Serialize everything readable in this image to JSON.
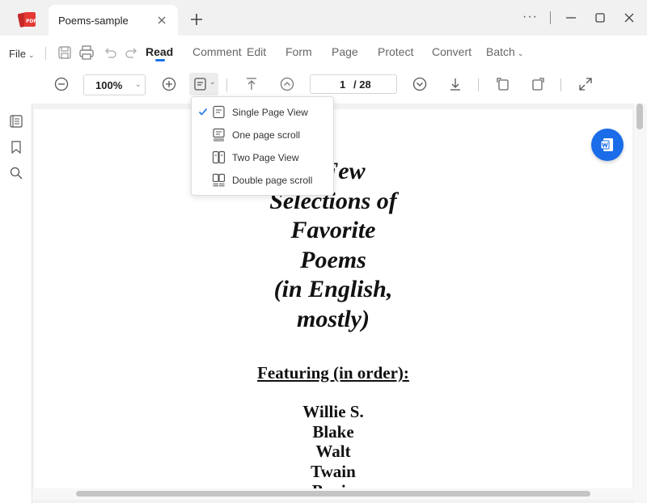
{
  "window": {
    "tab_title": "Poems-sample",
    "more_label": "···"
  },
  "menu": {
    "file_label": "File",
    "tabs": [
      "Read",
      "Comment",
      "Edit",
      "Form",
      "Page",
      "Protect",
      "Convert",
      "Batch"
    ],
    "active_tab": "Read"
  },
  "toolbar": {
    "zoom": "100%",
    "page_current": "1",
    "page_total": "/ 28"
  },
  "view_menu": {
    "items": [
      {
        "label": "Single Page View",
        "checked": true,
        "icon": "single-page-icon"
      },
      {
        "label": "One page scroll",
        "checked": false,
        "icon": "page-scroll-icon"
      },
      {
        "label": "Two Page View",
        "checked": false,
        "icon": "two-page-icon"
      },
      {
        "label": "Double page scroll",
        "checked": false,
        "icon": "double-scroll-icon"
      }
    ]
  },
  "document": {
    "title_lines": [
      "A Few",
      "Selections of",
      "Favorite",
      "Poems",
      "(in English,",
      "mostly)"
    ],
    "featuring": "Featuring (in order):",
    "authors": [
      "Willie S.",
      "Blake",
      "Walt",
      "Twain",
      "Bonio"
    ]
  },
  "colors": {
    "accent": "#1a73e8",
    "word_button": "#1a6ce8",
    "logo": "#e53935"
  }
}
